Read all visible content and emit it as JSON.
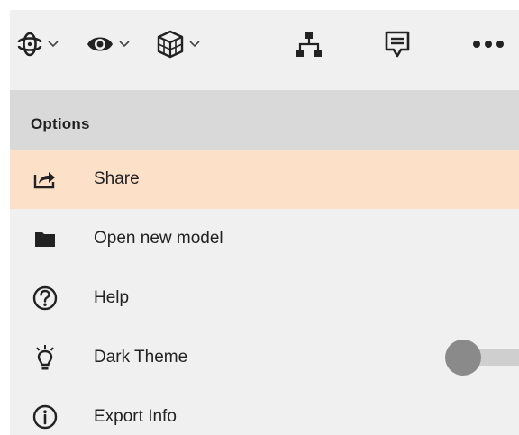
{
  "toolbar": {
    "items": [
      {
        "icon": "orbit-icon",
        "has_dropdown": true
      },
      {
        "icon": "eye-icon",
        "has_dropdown": true
      },
      {
        "icon": "cube-icon",
        "has_dropdown": true
      },
      {
        "icon": "hierarchy-icon",
        "has_dropdown": false
      },
      {
        "icon": "comment-icon",
        "has_dropdown": false
      },
      {
        "icon": "more-icon",
        "has_dropdown": false
      }
    ]
  },
  "options": {
    "title": "Options",
    "items": [
      {
        "label": "Share",
        "icon": "share-icon",
        "active": true
      },
      {
        "label": "Open new model",
        "icon": "folder-icon",
        "active": false
      },
      {
        "label": "Help",
        "icon": "help-icon",
        "active": false
      },
      {
        "label": "Dark Theme",
        "icon": "lightbulb-icon",
        "active": false,
        "toggle": false
      },
      {
        "label": "Export Info",
        "icon": "info-icon",
        "active": false
      }
    ]
  },
  "colors": {
    "panel_bg": "#f0f0f0",
    "header_bg": "#d9d9d9",
    "active_bg": "#fde0c8",
    "icon": "#222222"
  }
}
